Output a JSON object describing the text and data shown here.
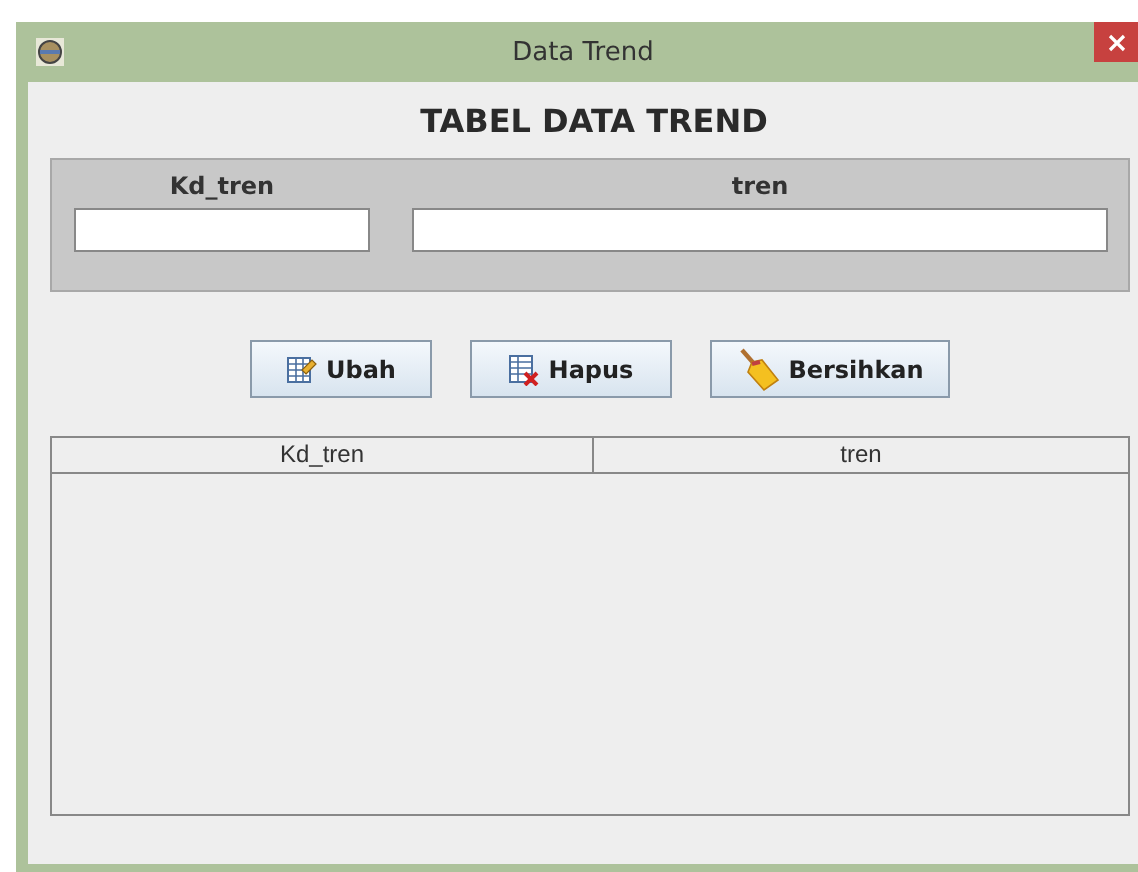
{
  "window": {
    "title": "Data Trend"
  },
  "heading": "TABEL DATA TREND",
  "form": {
    "fields": [
      {
        "label": "Kd_tren"
      },
      {
        "label": "tren"
      }
    ]
  },
  "buttons": [
    {
      "label": "Ubah",
      "kind": "edit"
    },
    {
      "label": "Hapus",
      "kind": "delete"
    },
    {
      "label": "Bersihkan",
      "kind": "clear"
    }
  ],
  "table": {
    "columns": [
      "Kd_tren",
      "tren"
    ]
  }
}
